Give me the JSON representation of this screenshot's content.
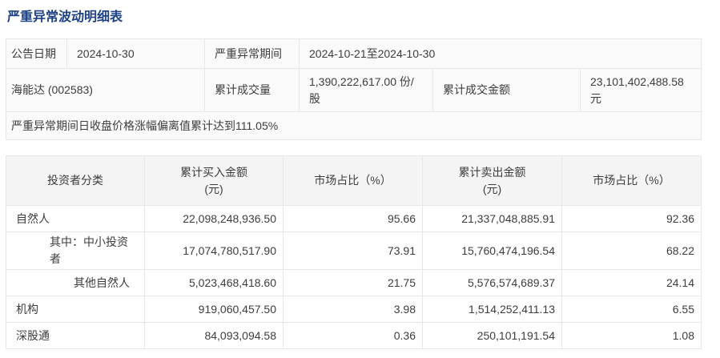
{
  "page": {
    "title": "严重异常波动明细表"
  },
  "colors": {
    "title_color": "#1d4183",
    "border_color": "#e8e8e8",
    "summary_bg": "#fafafa",
    "header_bg": "#f4f4f4",
    "text_color": "#3d3d3d"
  },
  "summary": {
    "announce_date_label": "公告日期",
    "announce_date": "2024-10-30",
    "period_label": "严重异常期间",
    "period": "2024-10-21至2024-10-30",
    "stock": "海能达 (002583)",
    "volume_label": "累计成交量",
    "volume": "1,390,222,617.00 份/\n股",
    "amount_label": "累计成交金额",
    "amount": "23,101,402,488.58\n元",
    "note": "严重异常期间日收盘价格涨幅偏离值累计达到111.05%"
  },
  "investor_table": {
    "headers": [
      "投资者分类",
      "累计买入金额\n(元)",
      "市场占比（%）",
      "累计卖出金额\n(元)",
      "市场占比（%）"
    ],
    "rows": [
      {
        "category": "自然人",
        "indent": 0,
        "buy": "22,098,248,936.50",
        "buy_pct": "95.66",
        "sell": "21,337,048,885.91",
        "sell_pct": "92.36"
      },
      {
        "category": "其中：中小投资者",
        "indent": 1,
        "buy": "17,074,780,517.90",
        "buy_pct": "73.91",
        "sell": "15,760,474,196.54",
        "sell_pct": "68.22"
      },
      {
        "category": "其他自然人",
        "indent": 2,
        "buy": "5,023,468,418.60",
        "buy_pct": "21.75",
        "sell": "5,576,574,689.37",
        "sell_pct": "24.14"
      },
      {
        "category": "机构",
        "indent": 0,
        "buy": "919,060,457.50",
        "buy_pct": "3.98",
        "sell": "1,514,252,411.13",
        "sell_pct": "6.55"
      },
      {
        "category": "深股通",
        "indent": 0,
        "buy": "84,093,094.58",
        "buy_pct": "0.36",
        "sell": "250,101,191.54",
        "sell_pct": "1.08"
      }
    ]
  }
}
